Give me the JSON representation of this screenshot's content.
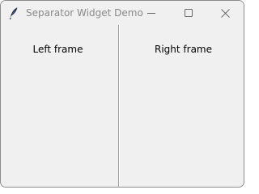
{
  "window": {
    "title": "Separator Widget Demo",
    "app_icon": "feather-icon",
    "controls": {
      "minimize_icon": "minimize-icon",
      "maximize_icon": "maximize-icon",
      "close_icon": "close-icon"
    }
  },
  "frames": {
    "left": {
      "label": "Left frame"
    },
    "right": {
      "label": "Right frame"
    }
  },
  "colors": {
    "window_bg": "#f0f0f0",
    "title_text": "#8a8a8a",
    "separator": "#a0a0a0"
  }
}
